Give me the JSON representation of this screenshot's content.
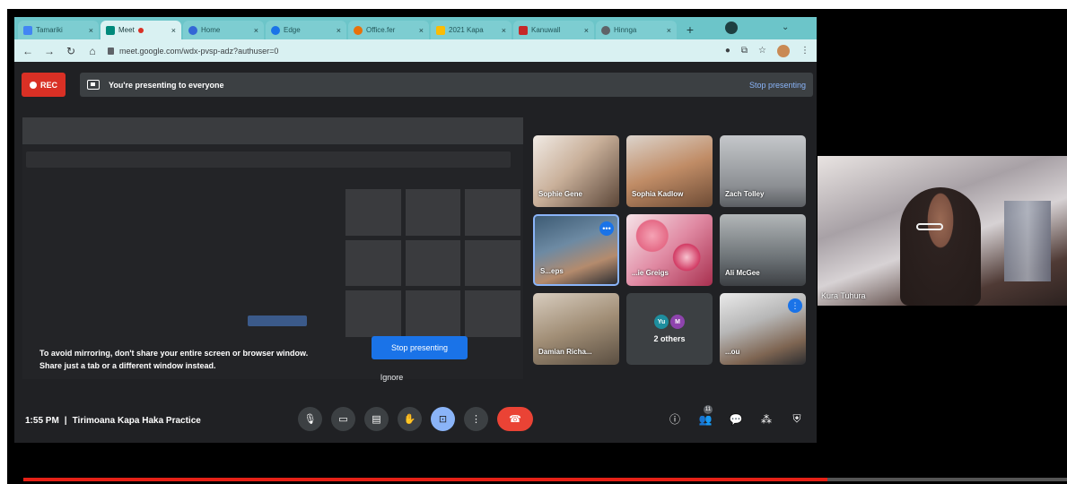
{
  "browser": {
    "tabs": [
      {
        "label": "Tamariki",
        "active": false
      },
      {
        "label": "Meet",
        "active": true,
        "recording": true
      },
      {
        "label": "Home",
        "active": false
      },
      {
        "label": "Edge",
        "active": false
      },
      {
        "label": "Office.fer",
        "active": false
      },
      {
        "label": "2021 Kapa",
        "active": false
      },
      {
        "label": "Kanuwall",
        "active": false
      },
      {
        "label": "Hinnga",
        "active": false
      }
    ],
    "new_tab": "+",
    "url": "meet.google.com/wdx-pvsp-adz?authuser=0"
  },
  "meet": {
    "rec_label": "REC",
    "presenting_banner": "You're presenting to everyone",
    "stop_presenting_link": "Stop presenting",
    "mirror_warning_line1": "To avoid mirroring, don't share your entire screen or browser window.",
    "mirror_warning_line2": "Share just a tab or a different window instead.",
    "stop_presenting_button": "Stop presenting",
    "ignore_button": "Ignore",
    "time": "1:55 PM",
    "separator": "|",
    "meeting_title": "Tirimoana Kapa Haka Practice",
    "participant_count": "11",
    "participants": [
      {
        "name": "Sophie Gene"
      },
      {
        "name": "Sophia Kadlow"
      },
      {
        "name": "Zach Tolley"
      },
      {
        "name": "S...eps"
      },
      {
        "name": "...ie Greigs"
      },
      {
        "name": "Ali McGee"
      },
      {
        "name": "Damian Richa..."
      },
      {
        "name": "2 others",
        "avatars": [
          "Yu",
          "M"
        ]
      },
      {
        "name": "...ou"
      }
    ]
  },
  "webcam": {
    "name": "Kura Tuhura"
  },
  "video": {
    "progress_fraction": 0.77
  },
  "colors": {
    "rec": "#d93025",
    "accent": "#1a73e8",
    "end_call": "#ea4335",
    "tab_strip": "#6cc5c9",
    "meet_bg": "#202124",
    "progress": "#e62117"
  }
}
